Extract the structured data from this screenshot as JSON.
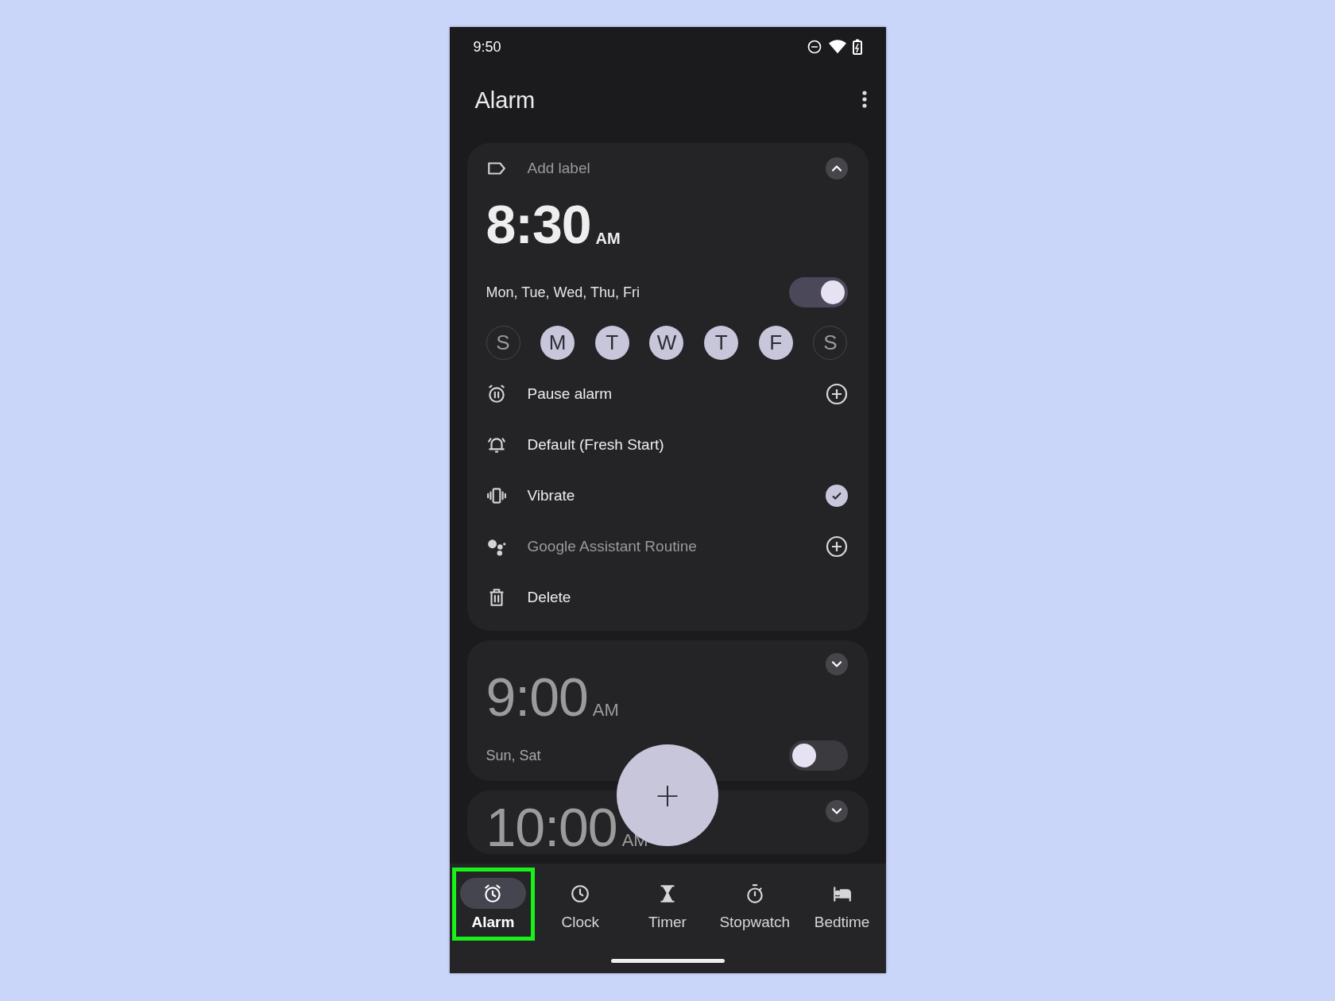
{
  "status_bar": {
    "time": "9:50"
  },
  "app_bar": {
    "title": "Alarm"
  },
  "alarms": [
    {
      "time": "8:30",
      "period": "AM",
      "expanded": true,
      "enabled": true,
      "label_placeholder": "Add label",
      "days_summary": "Mon, Tue, Wed, Thu, Fri",
      "days": [
        {
          "letter": "S",
          "selected": false
        },
        {
          "letter": "M",
          "selected": true
        },
        {
          "letter": "T",
          "selected": true
        },
        {
          "letter": "W",
          "selected": true
        },
        {
          "letter": "T",
          "selected": true
        },
        {
          "letter": "F",
          "selected": true
        },
        {
          "letter": "S",
          "selected": false
        }
      ],
      "options": [
        {
          "kind": "pause",
          "text": "Pause alarm",
          "dimmed": false
        },
        {
          "kind": "ringtone",
          "text": "Default (Fresh Start)",
          "dimmed": false
        },
        {
          "kind": "vibrate",
          "text": "Vibrate",
          "dimmed": false,
          "checked": true
        },
        {
          "kind": "assistant",
          "text": "Google Assistant Routine",
          "dimmed": true
        },
        {
          "kind": "delete",
          "text": "Delete",
          "dimmed": false
        }
      ]
    },
    {
      "time": "9:00",
      "period": "AM",
      "expanded": false,
      "enabled": false,
      "days_summary": "Sun, Sat"
    },
    {
      "time": "10:00",
      "period": "AM",
      "expanded": false
    }
  ],
  "fab": {
    "symbol": "+"
  },
  "nav": [
    {
      "kind": "alarm",
      "label": "Alarm",
      "selected": true,
      "highlighted": true
    },
    {
      "kind": "clock",
      "label": "Clock",
      "selected": false,
      "highlighted": false
    },
    {
      "kind": "timer",
      "label": "Timer",
      "selected": false,
      "highlighted": false
    },
    {
      "kind": "stopwatch",
      "label": "Stopwatch",
      "selected": false,
      "highlighted": false
    },
    {
      "kind": "bedtime",
      "label": "Bedtime",
      "selected": false,
      "highlighted": false
    }
  ]
}
